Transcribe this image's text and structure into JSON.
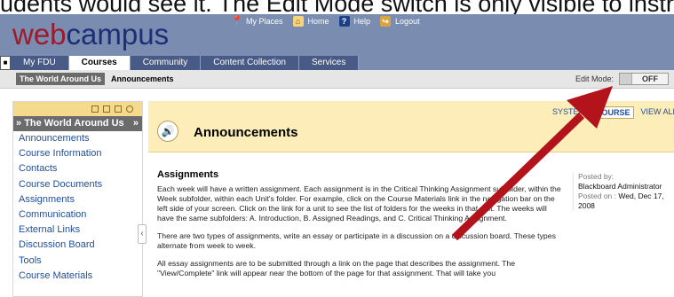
{
  "caption": {
    "text": "udents would see it. The Edit Mode switch is only visible to instr"
  },
  "logo": {
    "web": "web",
    "campus": "campus"
  },
  "top_links": [
    {
      "icon": "location-pin-icon",
      "label": "My Places"
    },
    {
      "icon": "home-icon",
      "label": "Home"
    },
    {
      "icon": "help-icon",
      "label": "Help"
    },
    {
      "icon": "logout-icon",
      "label": "Logout"
    }
  ],
  "tabs": [
    {
      "label": "My FDU",
      "active": false
    },
    {
      "label": "Courses",
      "active": true
    },
    {
      "label": "Community",
      "active": false
    },
    {
      "label": "Content Collection",
      "active": false
    },
    {
      "label": "Services",
      "active": false
    }
  ],
  "breadcrumb": {
    "course": "The World Around Us",
    "page": "Announcements"
  },
  "edit_mode": {
    "label": "Edit Mode:",
    "state": "OFF"
  },
  "sidebar": {
    "title": "The World Around Us",
    "items": [
      "Announcements",
      "Course Information",
      "Contacts",
      "Course Documents",
      "Assignments",
      "Communication",
      "External Links",
      "Discussion Board",
      "Tools",
      "Course Materials"
    ]
  },
  "announcements": {
    "title": "Announcements",
    "views": {
      "system": "SYSTEM",
      "course": "COURSE",
      "all": "VIEW ALL"
    }
  },
  "post": {
    "title": "Assignments",
    "p1": "Each week will have a written assignment. Each assignment is in the Critical Thinking Assignment subfolder, within the Week subfolder, within each Unit's folder. For example, click on the Course Materials link in the navigation bar on the left side of your screen. Click on the link for a unit to see the list of folders for the weeks in that unit. The weeks will have the same subfolders: A. Introduction, B. Assigned Readings, and C. Critical Thinking Assignment.",
    "p2": "There are two types of assignments, write an essay or participate in a discussion on a discussion board. These types alternate from week to week.",
    "p3": "All essay assignments are to be submitted through a link on the page that describes the assignment. The \"View/Complete\" link will appear near the bottom of the page for that assignment. That will take you"
  },
  "meta": {
    "posted_by_label": "Posted by:",
    "posted_by": "Blackboard Administrator",
    "posted_on_label": "Posted on :",
    "posted_on": "Wed, Dec 17, 2008"
  },
  "colors": {
    "arrow": "#b3141b",
    "header": "#7a8cb0",
    "ann_bg": "#fdeeb9",
    "link": "#1f4e9a"
  }
}
